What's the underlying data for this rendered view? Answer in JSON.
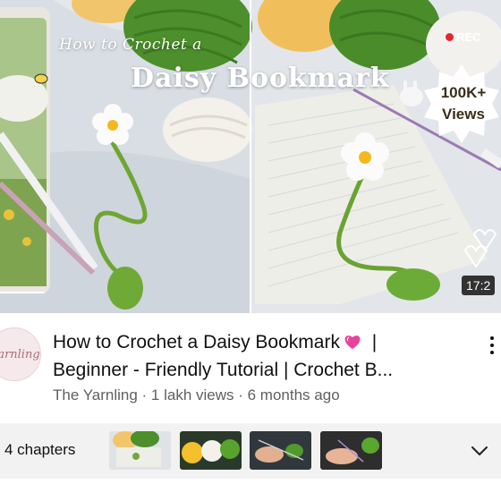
{
  "video": {
    "overlay_line1": "How to Crochet a",
    "overlay_line2": "Daisy Bookmark",
    "rec_label": "REC",
    "badge_line1": "100K+",
    "badge_line2": "Views",
    "duration": "17:2",
    "title_line1": "How to Crochet a Daisy Bookmark",
    "title_line1_suffix": "|",
    "title_line2": "Beginner - Friendly Tutorial | Crochet B...",
    "meta": "The Yarnling · 1 lakh views · 6 months ago",
    "channel_avatar_text": "arnling"
  },
  "chapters": {
    "label": "4 chapters",
    "count": 4
  },
  "icons": {
    "more": "more-vert-icon",
    "heart": "pink-heart-emoji",
    "expand": "chevron-down-icon"
  },
  "colors": {
    "accent_rec": "#e3262b",
    "meta_text": "#606060",
    "chapters_bg": "#f2f2f2"
  }
}
